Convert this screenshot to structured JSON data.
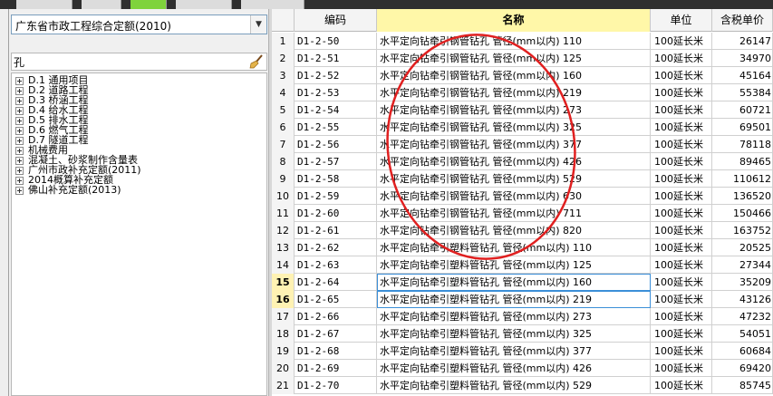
{
  "library_select": {
    "value": "广东省市政工程综合定额(2010)"
  },
  "search": {
    "value": "孔"
  },
  "tree": {
    "items": [
      {
        "label": "D.1 通用项目"
      },
      {
        "label": "D.2 道路工程"
      },
      {
        "label": "D.3 桥涵工程"
      },
      {
        "label": "D.4 给水工程"
      },
      {
        "label": "D.5 排水工程"
      },
      {
        "label": "D.6 燃气工程"
      },
      {
        "label": "D.7 隧道工程"
      },
      {
        "label": "机械费用"
      },
      {
        "label": "混凝土、砂浆制作含量表"
      },
      {
        "label": "广州市政补充定额(2011)"
      },
      {
        "label": "2014概算补充定额"
      },
      {
        "label": "佛山补充定额(2013)"
      }
    ]
  },
  "grid": {
    "columns": {
      "code": "编码",
      "name": "名称",
      "unit": "单位",
      "price": "含税单价"
    },
    "rows": [
      {
        "num": "1",
        "code": "D1-2-50",
        "name": "水平定向钻牵引钢管钻孔 管径(mm以内) 110",
        "unit": "100延长米",
        "price": "26147"
      },
      {
        "num": "2",
        "code": "D1-2-51",
        "name": "水平定向钻牵引钢管钻孔 管径(mm以内) 125",
        "unit": "100延长米",
        "price": "34970"
      },
      {
        "num": "3",
        "code": "D1-2-52",
        "name": "水平定向钻牵引钢管钻孔 管径(mm以内) 160",
        "unit": "100延长米",
        "price": "45164"
      },
      {
        "num": "4",
        "code": "D1-2-53",
        "name": "水平定向钻牵引钢管钻孔 管径(mm以内) 219",
        "unit": "100延长米",
        "price": "55384"
      },
      {
        "num": "5",
        "code": "D1-2-54",
        "name": "水平定向钻牵引钢管钻孔 管径(mm以内) 273",
        "unit": "100延长米",
        "price": "60721"
      },
      {
        "num": "6",
        "code": "D1-2-55",
        "name": "水平定向钻牵引钢管钻孔 管径(mm以内) 325",
        "unit": "100延长米",
        "price": "69501"
      },
      {
        "num": "7",
        "code": "D1-2-56",
        "name": "水平定向钻牵引钢管钻孔 管径(mm以内) 377",
        "unit": "100延长米",
        "price": "78118"
      },
      {
        "num": "8",
        "code": "D1-2-57",
        "name": "水平定向钻牵引钢管钻孔 管径(mm以内) 426",
        "unit": "100延长米",
        "price": "89465"
      },
      {
        "num": "9",
        "code": "D1-2-58",
        "name": "水平定向钻牵引钢管钻孔 管径(mm以内) 529",
        "unit": "100延长米",
        "price": "110612"
      },
      {
        "num": "10",
        "code": "D1-2-59",
        "name": "水平定向钻牵引钢管钻孔 管径(mm以内) 630",
        "unit": "100延长米",
        "price": "136520"
      },
      {
        "num": "11",
        "code": "D1-2-60",
        "name": "水平定向钻牵引钢管钻孔 管径(mm以内) 711",
        "unit": "100延长米",
        "price": "150466"
      },
      {
        "num": "12",
        "code": "D1-2-61",
        "name": "水平定向钻牵引钢管钻孔 管径(mm以内) 820",
        "unit": "100延长米",
        "price": "163752"
      },
      {
        "num": "13",
        "code": "D1-2-62",
        "name": "水平定向钻牵引塑料管钻孔 管径(mm以内) 110",
        "unit": "100延长米",
        "price": "20525"
      },
      {
        "num": "14",
        "code": "D1-2-63",
        "name": "水平定向钻牵引塑料管钻孔 管径(mm以内) 125",
        "unit": "100延长米",
        "price": "27344"
      },
      {
        "num": "15",
        "code": "D1-2-64",
        "name": "水平定向钻牵引塑料管钻孔 管径(mm以内) 160",
        "unit": "100延长米",
        "price": "35209",
        "highlight": true
      },
      {
        "num": "16",
        "code": "D1-2-65",
        "name": "水平定向钻牵引塑料管钻孔 管径(mm以内) 219",
        "unit": "100延长米",
        "price": "43126",
        "highlight": true
      },
      {
        "num": "17",
        "code": "D1-2-66",
        "name": "水平定向钻牵引塑料管钻孔 管径(mm以内) 273",
        "unit": "100延长米",
        "price": "47232"
      },
      {
        "num": "18",
        "code": "D1-2-67",
        "name": "水平定向钻牵引塑料管钻孔 管径(mm以内) 325",
        "unit": "100延长米",
        "price": "54051"
      },
      {
        "num": "19",
        "code": "D1-2-68",
        "name": "水平定向钻牵引塑料管钻孔 管径(mm以内) 377",
        "unit": "100延长米",
        "price": "60684"
      },
      {
        "num": "20",
        "code": "D1-2-69",
        "name": "水平定向钻牵引塑料管钻孔 管径(mm以内) 426",
        "unit": "100延长米",
        "price": "69420"
      },
      {
        "num": "21",
        "code": "D1-2-70",
        "name": "水平定向钻牵引塑料管钻孔 管径(mm以内) 529",
        "unit": "100延长米",
        "price": "85745"
      }
    ]
  },
  "colors": {
    "active_tab": "#7fd33c",
    "header_highlight": "#fff7a8",
    "selection_border": "#3b8fd8",
    "annotation_circle": "#e02020"
  }
}
